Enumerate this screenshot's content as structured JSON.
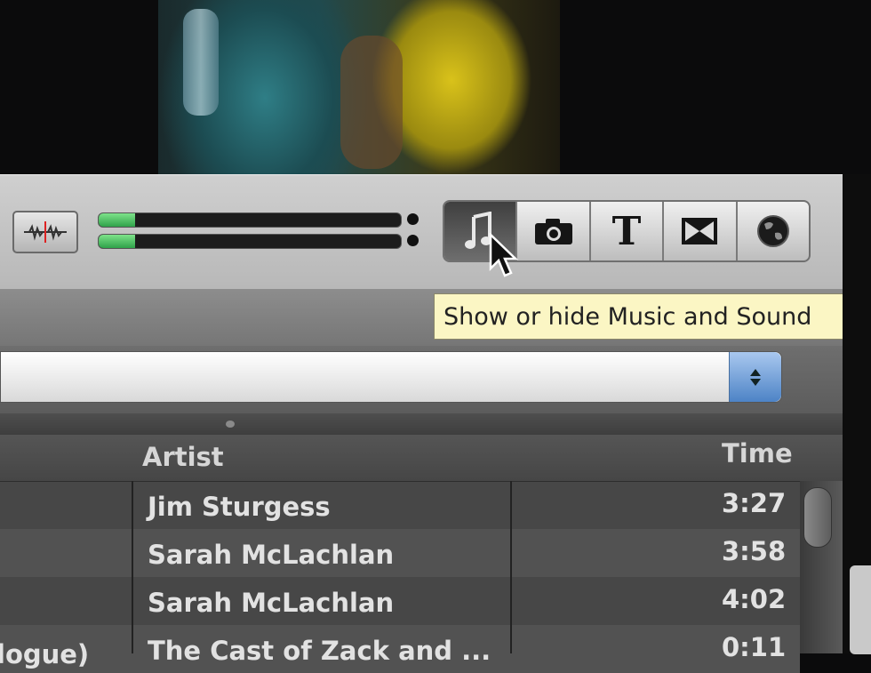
{
  "tooltip": {
    "text": "Show or hide Music and Sound"
  },
  "meters": {
    "left_level_pct": 12,
    "right_level_pct": 12
  },
  "toolbar": {
    "buttons": [
      {
        "icon": "music-note-icon",
        "active": true
      },
      {
        "icon": "camera-icon",
        "active": false
      },
      {
        "icon": "title-text-icon",
        "active": false
      },
      {
        "icon": "transitions-icon",
        "active": false
      },
      {
        "icon": "globe-icon",
        "active": false
      }
    ],
    "title_glyph": "T"
  },
  "table": {
    "columns": {
      "artist": "Artist",
      "time": "Time"
    },
    "rows": [
      {
        "name": "",
        "artist": "Jim Sturgess",
        "time": "3:27"
      },
      {
        "name": "",
        "artist": "Sarah McLachlan",
        "time": "3:58"
      },
      {
        "name": "",
        "artist": "Sarah McLachlan",
        "time": "4:02"
      },
      {
        "name": "logue)",
        "artist": "The Cast of Zack and ...",
        "time": "0:11"
      }
    ]
  },
  "colors": {
    "accent_blue": "#4d83c6",
    "meter_green": "#2fa24a",
    "tooltip_bg": "#fbf6c4"
  }
}
